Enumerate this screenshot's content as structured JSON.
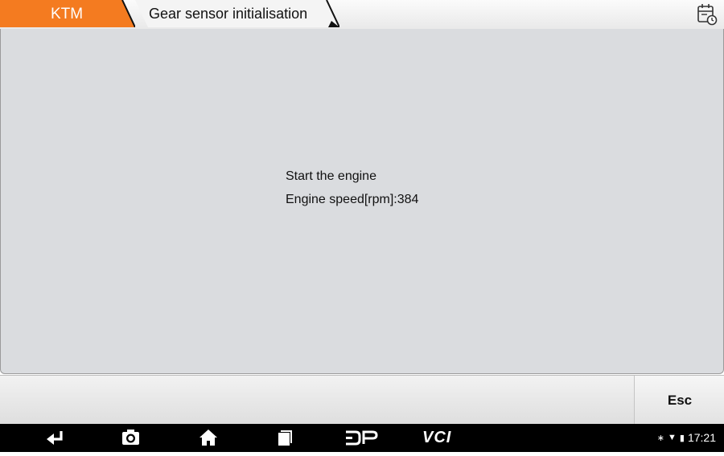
{
  "breadcrumb": {
    "brand": "KTM",
    "title": "Gear sensor initialisation"
  },
  "main": {
    "line1": "Start the engine",
    "line2": "Engine speed[rpm]:384"
  },
  "buttons": {
    "esc_label": "Esc"
  },
  "navbar": {
    "dp_label": "DP",
    "vci_label": "VCI",
    "time": "17:21",
    "bluetooth_glyph": "∗",
    "wifi_glyph": "▼",
    "battery_glyph": "▮"
  },
  "colors": {
    "brand_orange": "#f47b20",
    "dialog_bg": "#dadcdf"
  },
  "icons": [
    "calendar-clock-icon",
    "back-icon",
    "camera-icon",
    "home-icon",
    "recent-apps-icon",
    "dp-icon",
    "vci-icon",
    "bluetooth-icon",
    "wifi-icon",
    "battery-icon"
  ]
}
